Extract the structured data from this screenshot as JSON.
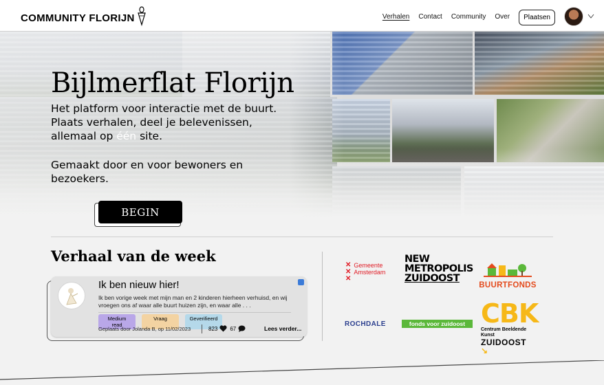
{
  "header": {
    "brand": "COMMUNITY FLORIJN",
    "nav": [
      "Verhalen",
      "Contact",
      "Community",
      "Over"
    ],
    "place_button": "Plaatsen"
  },
  "hero": {
    "title": "Bijlmerflat Florijn",
    "text1_a": "Het platform voor interactie met de buurt. Plaats verhalen, deel je belevenissen, allemaal op ",
    "text1_highlight": "één",
    "text1_b": " site.",
    "text2": "Gemaakt door en voor bewoners en bezoekers.",
    "cta": "BEGIN"
  },
  "week": {
    "title": "Verhaal van de week",
    "story": {
      "title": "Ik ben nieuw hier!",
      "text": "Ik ben vorige week met mijn man en 2 kinderen hierheen verhuisd, en wij vroegen ons af waar alle buurt huizen zijn, en waar alle . . .",
      "tags": [
        "Medium read",
        "Vraag",
        "Geverifieerd"
      ],
      "posted": "Geplaats door Jolanda B, op 11/02/2023",
      "likes": "823",
      "comments": "67",
      "read_more": "Lees verder..."
    }
  },
  "partners": {
    "amsterdam": [
      "Gemeente",
      "Amsterdam"
    ],
    "nmz": [
      "NEW",
      "METROPOLIS",
      "ZUIDOOST"
    ],
    "buurtfonds": "BUURTFONDS",
    "rochdale": "ROCHDALE",
    "fonds": "fonds voor zuidoost",
    "cbk": "CBK",
    "cbk_sub": "Centrum Beeldende Kunst",
    "cbk_zuidoost": "ZUIDOOST"
  },
  "colors": {
    "amsterdam_red": "#e01a24",
    "buurtfonds_orange": "#e44a1c",
    "rochdale_blue": "#2a3e8e",
    "fonds_green": "#5bb83a",
    "cbk_yellow": "#f6b818"
  }
}
